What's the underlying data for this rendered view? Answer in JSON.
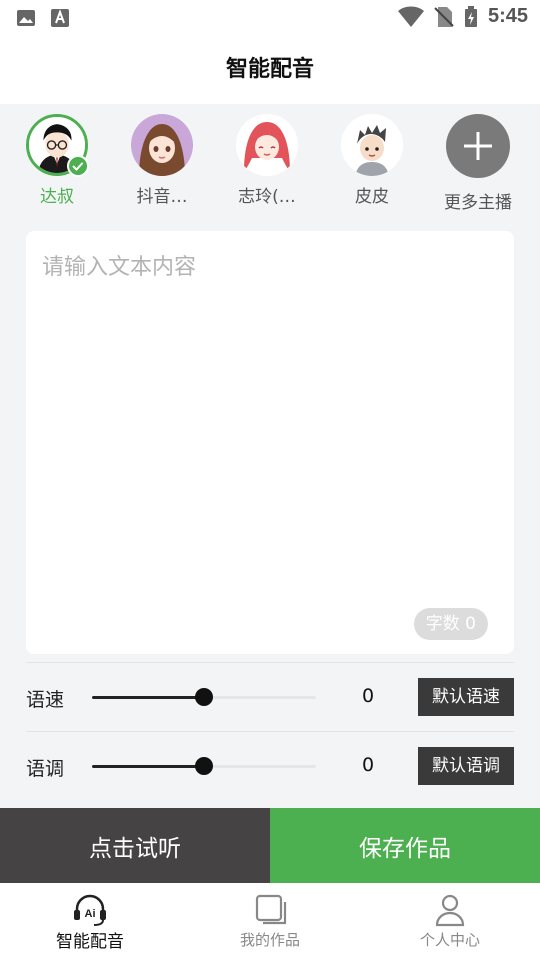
{
  "status_bar": {
    "time": "5:45"
  },
  "header": {
    "title": "智能配音"
  },
  "voices": [
    {
      "name": "达叔",
      "selected": true
    },
    {
      "name": "抖音…",
      "selected": false
    },
    {
      "name": "志玲(…",
      "selected": false
    },
    {
      "name": "皮皮",
      "selected": false
    }
  ],
  "more_voices_label": "更多主播",
  "text_input": {
    "placeholder": "请输入文本内容",
    "value": ""
  },
  "char_count_label": "字数 0",
  "speed": {
    "label": "语速",
    "value": "0",
    "level": 0.5,
    "default_label": "默认语速"
  },
  "pitch": {
    "label": "语调",
    "value": "0",
    "level": 0.5,
    "default_label": "默认语调"
  },
  "actions": {
    "preview_label": "点击试听",
    "save_label": "保存作品"
  },
  "bottom_nav": [
    {
      "label": "智能配音",
      "icon": "headset-ai-icon",
      "active": true
    },
    {
      "label": "我的作品",
      "icon": "works-icon",
      "active": false
    },
    {
      "label": "个人中心",
      "icon": "user-icon",
      "active": false
    }
  ],
  "colors": {
    "accent": "#4caf50",
    "dark_button": "#454343",
    "default_button": "#3a3a3a"
  }
}
